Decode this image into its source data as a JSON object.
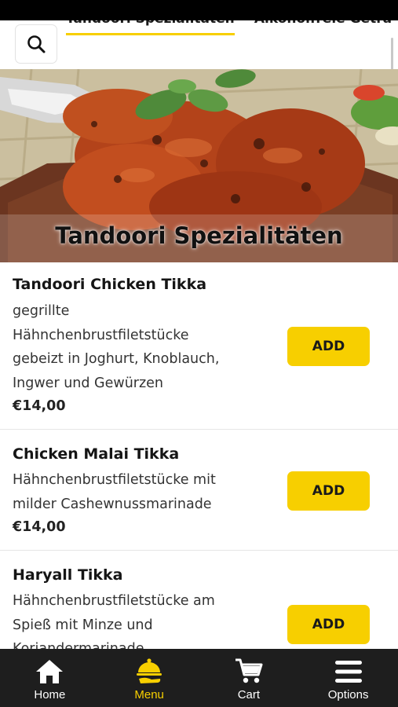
{
  "colors": {
    "accent": "#f7cf00",
    "nav_bg": "#1e1e1e",
    "text": "#1a1a1a"
  },
  "top_bar": {
    "search_icon": "search-icon",
    "tabs": [
      {
        "label": "Tandoori Spezialitäten",
        "active": true
      },
      {
        "label": "Alkoholfreie Geträ",
        "active": false
      }
    ]
  },
  "hero": {
    "title": "Tandoori Spezialitäten"
  },
  "items": [
    {
      "name": "Tandoori Chicken Tikka",
      "description_lines": [
        "gegrillte",
        "Hähnchenbrustfiletstücke",
        "gebeizt in Joghurt, Knoblauch,",
        "Ingwer und Gewürzen"
      ],
      "price": "€14,00",
      "button": "ADD"
    },
    {
      "name": "Chicken Malai Tikka",
      "description_lines": [
        "Hähnchenbrustfiletstücke mit",
        "milder Cashewnussmarinade"
      ],
      "price": "€14,00",
      "button": "ADD"
    },
    {
      "name": "Haryall Tikka",
      "description_lines": [
        "Hähnchenbrustfiletstücke am",
        "Spieß mit Minze und",
        "Koriandermarinade"
      ],
      "button": "ADD"
    }
  ],
  "bottom_nav": [
    {
      "label": "Home",
      "icon": "home-icon",
      "active": false
    },
    {
      "label": "Menu",
      "icon": "cloche-icon",
      "active": true
    },
    {
      "label": "Cart",
      "icon": "cart-icon",
      "active": false
    },
    {
      "label": "Options",
      "icon": "hamburger-icon",
      "active": false
    }
  ]
}
